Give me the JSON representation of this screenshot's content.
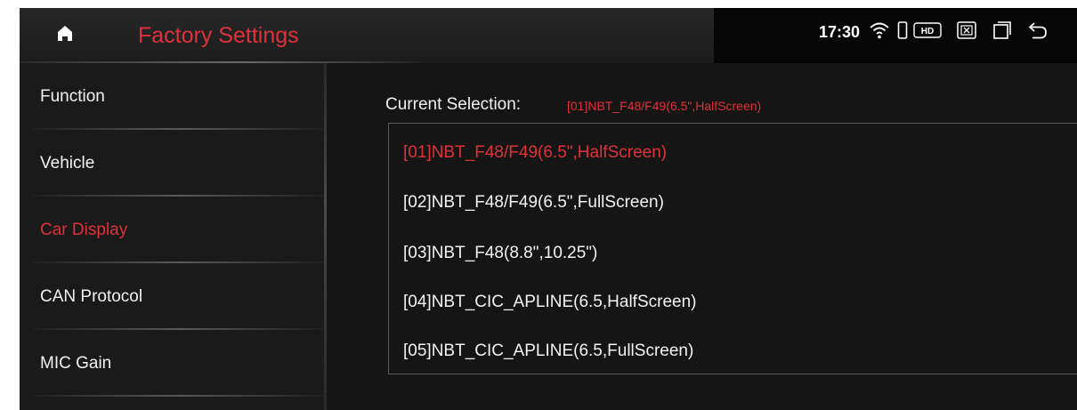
{
  "header": {
    "title": "Factory Settings",
    "time": "17:30",
    "status_icons": [
      "home-icon",
      "wifi-icon",
      "phone-icon",
      "hd-icon",
      "close-box-icon",
      "recent-apps-icon",
      "back-icon"
    ]
  },
  "sidebar": {
    "items": [
      {
        "label": "Function",
        "active": false
      },
      {
        "label": "Vehicle",
        "active": false
      },
      {
        "label": "Car Display",
        "active": true
      },
      {
        "label": "CAN Protocol",
        "active": false
      },
      {
        "label": "MIC Gain",
        "active": false
      }
    ]
  },
  "main": {
    "current_label": "Current Selection:",
    "current_value": "[01]NBT_F48/F49(6.5\",HalfScreen)",
    "options": [
      {
        "label": "[01]NBT_F48/F49(6.5\",HalfScreen)",
        "selected": true
      },
      {
        "label": "[02]NBT_F48/F49(6.5\",FullScreen)",
        "selected": false
      },
      {
        "label": "[03]NBT_F48(8.8\",10.25\")",
        "selected": false
      },
      {
        "label": "[04]NBT_CIC_APLINE(6.5,HalfScreen)",
        "selected": false
      },
      {
        "label": "[05]NBT_CIC_APLINE(6.5,FullScreen)",
        "selected": false
      }
    ]
  },
  "colors": {
    "accent": "#e0313a",
    "background": "#151515",
    "text": "#f2f2f2"
  }
}
